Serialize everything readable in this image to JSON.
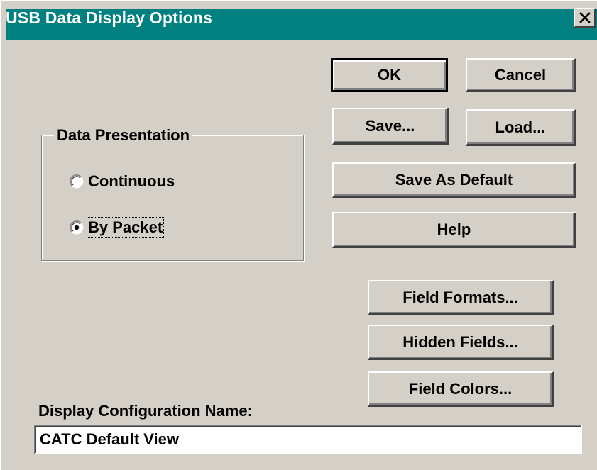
{
  "window": {
    "title": "USB Data Display Options",
    "close_glyph": "✕"
  },
  "buttons": {
    "ok": "OK",
    "cancel": "Cancel",
    "save": "Save...",
    "load": "Load...",
    "save_as_default": "Save As Default",
    "help": "Help",
    "field_formats": "Field Formats...",
    "hidden_fields": "Hidden Fields...",
    "field_colors": "Field Colors..."
  },
  "data_presentation": {
    "label": "Data Presentation",
    "options": [
      {
        "label": "Continuous",
        "selected": false
      },
      {
        "label": "By Packet",
        "selected": true
      }
    ]
  },
  "config_name": {
    "label": "Display Configuration Name:",
    "value": "CATC Default View"
  },
  "colors": {
    "titlebar": "#008080",
    "dialog_bg": "#d4d0c8"
  }
}
